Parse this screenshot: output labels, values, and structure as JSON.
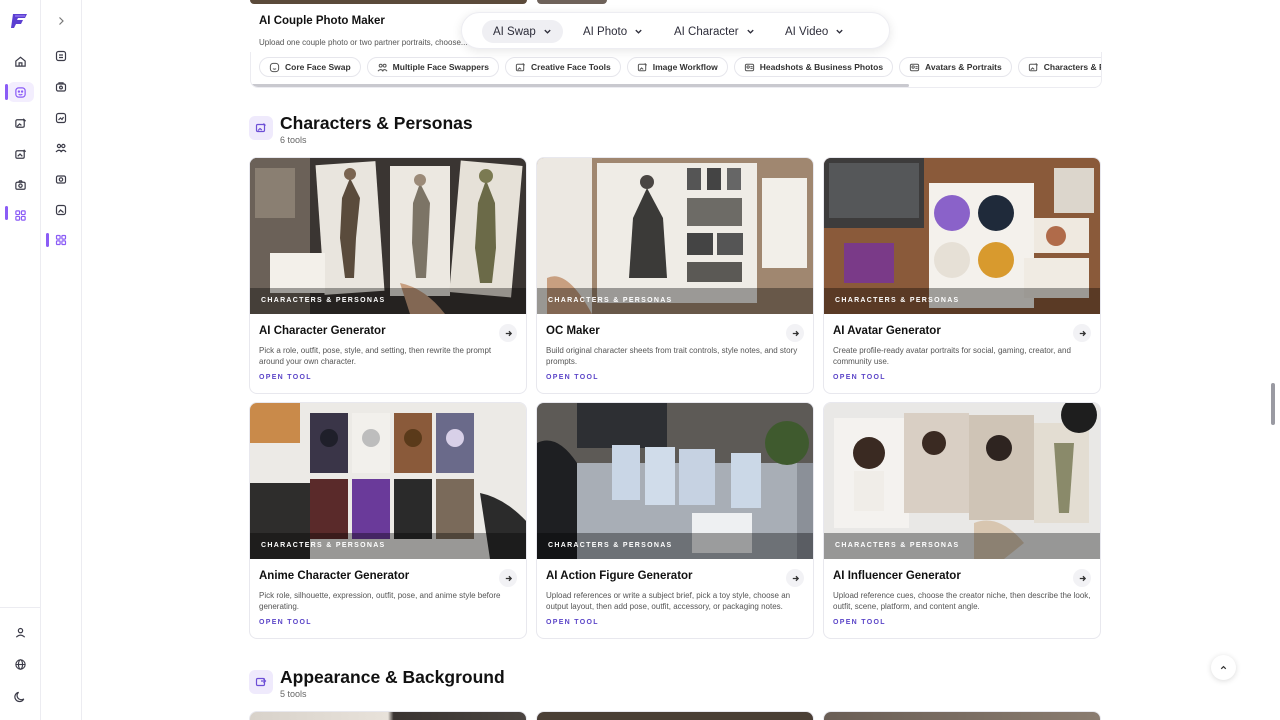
{
  "top_card": {
    "title": "AI Couple Photo Maker",
    "description": "Upload one couple photo or two partner portraits, choose... then add real the pose, outfit, background, ... detail..."
  },
  "nav": {
    "tabs": [
      {
        "label": "AI Swap",
        "selected": true
      },
      {
        "label": "AI Photo",
        "selected": false
      },
      {
        "label": "AI Character",
        "selected": false
      },
      {
        "label": "AI Video",
        "selected": false
      }
    ]
  },
  "chips": [
    {
      "label": "Core Face Swap",
      "icon": "face-icon"
    },
    {
      "label": "Multiple Face Swappers",
      "icon": "people-icon"
    },
    {
      "label": "Creative Face Tools",
      "icon": "image-edit-icon"
    },
    {
      "label": "Image Workflow",
      "icon": "image-edit-icon"
    },
    {
      "label": "Headshots & Business Photos",
      "icon": "headshot-icon"
    },
    {
      "label": "Avatars & Portraits",
      "icon": "headshot-icon"
    },
    {
      "label": "Characters & Personas",
      "icon": "image-edit-icon"
    }
  ],
  "sections": [
    {
      "title": "Characters & Personas",
      "count": "6 tools",
      "cards": [
        {
          "tag": "CHARACTERS & PERSONAS",
          "title": "AI Character Generator",
          "description": "Pick a role, outfit, pose, style, and setting, then rewrite the prompt around your own character.",
          "cta": "OPEN TOOL"
        },
        {
          "tag": "CHARACTERS & PERSONAS",
          "title": "OC Maker",
          "description": "Build original character sheets from trait controls, style notes, and story prompts.",
          "cta": "OPEN TOOL"
        },
        {
          "tag": "CHARACTERS & PERSONAS",
          "title": "AI Avatar Generator",
          "description": "Create profile-ready avatar portraits for social, gaming, creator, and community use.",
          "cta": "OPEN TOOL"
        },
        {
          "tag": "CHARACTERS & PERSONAS",
          "title": "Anime Character Generator",
          "description": "Pick role, silhouette, expression, outfit, pose, and anime style before generating.",
          "cta": "OPEN TOOL"
        },
        {
          "tag": "CHARACTERS & PERSONAS",
          "title": "AI Action Figure Generator",
          "description": "Upload references or write a subject brief, pick a toy style, choose an output layout, then add pose, outfit, accessory, or packaging notes.",
          "cta": "OPEN TOOL"
        },
        {
          "tag": "CHARACTERS & PERSONAS",
          "title": "AI Influencer Generator",
          "description": "Upload reference cues, choose the creator niche, then describe the look, outfit, scene, platform, and content angle.",
          "cta": "OPEN TOOL"
        }
      ]
    },
    {
      "title": "Appearance & Background",
      "count": "5 tools"
    }
  ],
  "colors": {
    "accent": "#8b5cf6",
    "cta": "#5b45c8"
  }
}
